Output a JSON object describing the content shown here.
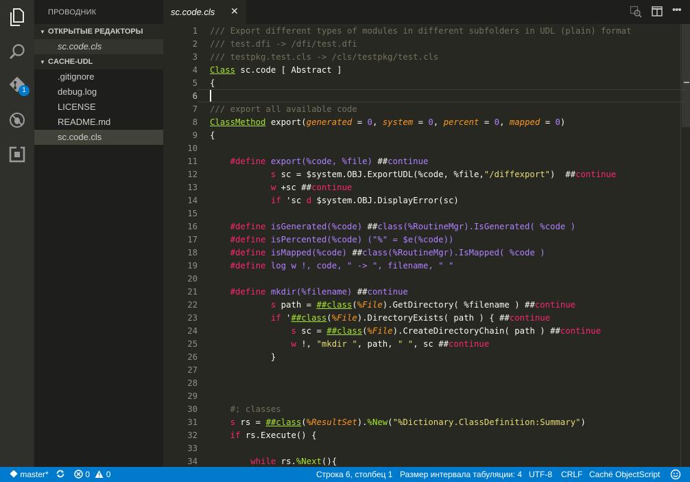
{
  "sidebar": {
    "title": "ПРОВОДНИК",
    "open_editors": {
      "header": "ОТКРЫТЫЕ РЕДАКТОРЫ",
      "files": [
        "sc.code.cls"
      ]
    },
    "workspace": {
      "header": "CACHE-UDL",
      "files": [
        ".gitignore",
        "debug.log",
        "LICENSE",
        "README.md",
        "sc.code.cls"
      ]
    }
  },
  "activity_bar": {
    "items": [
      "files-icon",
      "search-icon",
      "git-icon",
      "debug-icon",
      "extensions-icon"
    ],
    "git_badge": "1"
  },
  "tab": {
    "label": "sc.code.cls",
    "close": "✕"
  },
  "editor": {
    "line_numbers": [
      "1",
      "2",
      "3",
      "4",
      "5",
      "6",
      "7",
      "8",
      "9",
      "10",
      "11",
      "12",
      "13",
      "14",
      "15",
      "16",
      "17",
      "18",
      "19",
      "20",
      "21",
      "22",
      "23",
      "24",
      "25",
      "26",
      "27",
      "28",
      "29",
      "30",
      "31",
      "32",
      "33",
      "34"
    ],
    "lines": [
      [
        [
          "c",
          "/// Export different types of modules in different subfolders in UDL (plain) format"
        ]
      ],
      [
        [
          "c",
          "/// test.dfi -> /dfi/test.dfi"
        ]
      ],
      [
        [
          "c",
          "/// testpkg.test.cls -> /cls/testpkg/test.cls"
        ]
      ],
      [
        [
          "gu",
          "Class"
        ],
        [
          "a",
          " sc.code [ Abstract ]"
        ]
      ],
      [
        [
          "a",
          "{"
        ]
      ],
      [],
      [
        [
          "c",
          "/// export all available code"
        ]
      ],
      [
        [
          "gu",
          "ClassMethod"
        ],
        [
          "a",
          " export("
        ],
        [
          "o",
          "generated"
        ],
        [
          "a",
          " = "
        ],
        [
          "p",
          "0"
        ],
        [
          "a",
          ", "
        ],
        [
          "o",
          "system"
        ],
        [
          "a",
          " = "
        ],
        [
          "p",
          "0"
        ],
        [
          "a",
          ", "
        ],
        [
          "o",
          "percent"
        ],
        [
          "a",
          " = "
        ],
        [
          "p",
          "0"
        ],
        [
          "a",
          ", "
        ],
        [
          "o",
          "mapped"
        ],
        [
          "a",
          " = "
        ],
        [
          "p",
          "0"
        ],
        [
          "a",
          ")"
        ]
      ],
      [
        [
          "a",
          "{"
        ]
      ],
      [],
      [
        [
          "a",
          "    "
        ],
        [
          "k",
          "#define"
        ],
        [
          "a",
          " "
        ],
        [
          "p",
          "export(%code, %file)"
        ],
        [
          "a",
          " ##"
        ],
        [
          "p",
          "continue"
        ]
      ],
      [
        [
          "a",
          "            "
        ],
        [
          "k",
          "s"
        ],
        [
          "a",
          " sc = $system.OBJ.ExportUDL(%code, %file,"
        ],
        [
          "s",
          "\"/diffexport\""
        ],
        [
          "a",
          ")  ##"
        ],
        [
          "k",
          "continue"
        ]
      ],
      [
        [
          "a",
          "            "
        ],
        [
          "k",
          "w"
        ],
        [
          "a",
          " +sc ##"
        ],
        [
          "k",
          "continue"
        ]
      ],
      [
        [
          "a",
          "            "
        ],
        [
          "k",
          "if"
        ],
        [
          "a",
          " 'sc "
        ],
        [
          "k",
          "d"
        ],
        [
          "a",
          " $system.OBJ.DisplayError(sc)"
        ]
      ],
      [],
      [
        [
          "a",
          "    "
        ],
        [
          "k",
          "#define"
        ],
        [
          "a",
          " "
        ],
        [
          "p",
          "isGenerated(%code)"
        ],
        [
          "a",
          " ##"
        ],
        [
          "p",
          "class(%RoutineMgr).IsGenerated( %code )"
        ]
      ],
      [
        [
          "a",
          "    "
        ],
        [
          "k",
          "#define"
        ],
        [
          "a",
          " "
        ],
        [
          "p",
          "isPercented(%code)"
        ],
        [
          "a",
          " "
        ],
        [
          "p",
          "(\"%\" = $e(%code))"
        ]
      ],
      [
        [
          "a",
          "    "
        ],
        [
          "k",
          "#define"
        ],
        [
          "a",
          " "
        ],
        [
          "p",
          "isMapped(%code)"
        ],
        [
          "a",
          " ##"
        ],
        [
          "p",
          "class(%RoutineMgr).IsMapped( %code )"
        ]
      ],
      [
        [
          "a",
          "    "
        ],
        [
          "k",
          "#define"
        ],
        [
          "a",
          " "
        ],
        [
          "p",
          "log w !, code, \" -> \", filename, \" \""
        ]
      ],
      [],
      [
        [
          "a",
          "    "
        ],
        [
          "k",
          "#define"
        ],
        [
          "a",
          " "
        ],
        [
          "p",
          "mkdir(%filename)"
        ],
        [
          "a",
          " ##"
        ],
        [
          "p",
          "continue"
        ]
      ],
      [
        [
          "a",
          "            "
        ],
        [
          "k",
          "s"
        ],
        [
          "a",
          " path = "
        ],
        [
          "gu",
          "##class"
        ],
        [
          "a",
          "("
        ],
        [
          "o",
          "%File"
        ],
        [
          "a",
          ").GetDirectory( %filename ) ##"
        ],
        [
          "k",
          "continue"
        ]
      ],
      [
        [
          "a",
          "            "
        ],
        [
          "k",
          "if"
        ],
        [
          "a",
          " '"
        ],
        [
          "gu",
          "##class"
        ],
        [
          "a",
          "("
        ],
        [
          "o",
          "%File"
        ],
        [
          "a",
          ").DirectoryExists( path ) { ##"
        ],
        [
          "k",
          "continue"
        ]
      ],
      [
        [
          "a",
          "                "
        ],
        [
          "k",
          "s"
        ],
        [
          "a",
          " sc = "
        ],
        [
          "gu",
          "##class"
        ],
        [
          "a",
          "("
        ],
        [
          "o",
          "%File"
        ],
        [
          "a",
          ").CreateDirectoryChain( path ) ##"
        ],
        [
          "k",
          "continue"
        ]
      ],
      [
        [
          "a",
          "                "
        ],
        [
          "k",
          "w"
        ],
        [
          "a",
          " !, "
        ],
        [
          "s",
          "\"mkdir \""
        ],
        [
          "a",
          ", path, "
        ],
        [
          "s",
          "\" \""
        ],
        [
          "a",
          ", sc ##"
        ],
        [
          "k",
          "continue"
        ]
      ],
      [
        [
          "a",
          "            }"
        ]
      ],
      [],
      [],
      [],
      [
        [
          "a",
          "    "
        ],
        [
          "c",
          "#; classes"
        ]
      ],
      [
        [
          "a",
          "    "
        ],
        [
          "k",
          "s"
        ],
        [
          "a",
          " rs = "
        ],
        [
          "gu",
          "##class"
        ],
        [
          "a",
          "("
        ],
        [
          "o",
          "%ResultSet"
        ],
        [
          "a",
          ")."
        ],
        [
          "g",
          "%New"
        ],
        [
          "a",
          "("
        ],
        [
          "s",
          "\"%Dictionary.ClassDefinition:Summary\""
        ],
        [
          "a",
          ")"
        ]
      ],
      [
        [
          "a",
          "    "
        ],
        [
          "k",
          "if"
        ],
        [
          "a",
          " rs.Execute() {"
        ]
      ],
      [],
      [
        [
          "a",
          "        "
        ],
        [
          "k",
          "while"
        ],
        [
          "a",
          " rs."
        ],
        [
          "g",
          "%Next"
        ],
        [
          "a",
          "(){"
        ]
      ]
    ]
  },
  "status": {
    "branch": "master*",
    "errors": "0",
    "warnings": "0",
    "position": "Строка 6, столбец 1",
    "tab_size": "Размер интервала табуляции: 4",
    "encoding": "UTF-8",
    "eol": "CRLF",
    "language": "Caché ObjectScript"
  }
}
